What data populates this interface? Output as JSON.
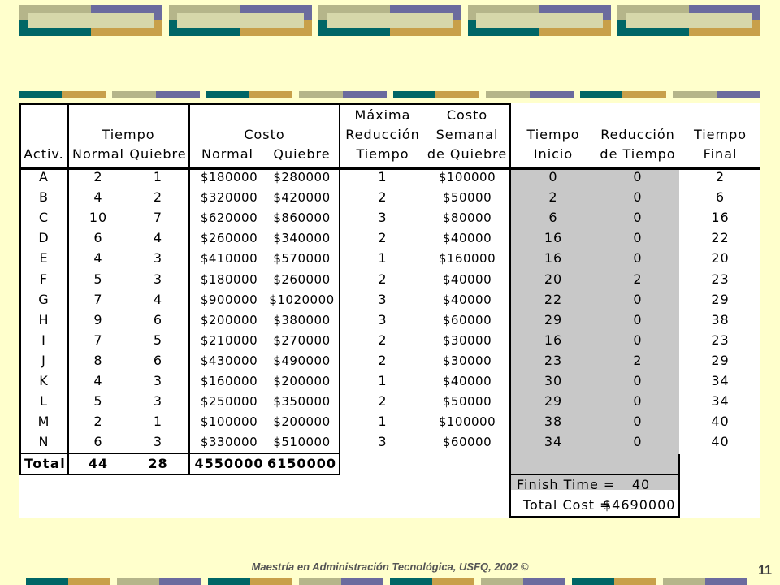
{
  "slide": {
    "footer": "Maestría en Administración Tecnológica, USFQ,  2002 ©",
    "page_number": "11",
    "colors": {
      "background": "#ffffcc",
      "teal": "#006666",
      "olive": "#b5b58a",
      "purple": "#6b6b9e",
      "gold": "#c8a04a",
      "gray_cell": "#c8c8c8"
    }
  },
  "table": {
    "headers": {
      "activ": "Activ.",
      "tiempo": "Tiempo",
      "normal_t": "Normal",
      "quiebre_t": "Quiebre",
      "costo": "Costo",
      "normal_c": "Normal",
      "quiebre_c": "Quiebre",
      "max_1": "Máxima",
      "max_2": "Reducción",
      "max_3": "Tiempo",
      "cs_1": "Costo",
      "cs_2": "Semanal",
      "cs_3": "de Quiebre",
      "ti_1": "Tiempo",
      "ti_2": "Inicio",
      "rt_1": "Reducción",
      "rt_2": "de Tiempo",
      "tf_1": "Tiempo",
      "tf_2": "Final"
    },
    "rows": [
      [
        "A",
        "2",
        "1",
        "$180000",
        "$280000",
        "1",
        "$100000",
        "0",
        "0",
        "2"
      ],
      [
        "B",
        "4",
        "2",
        "$320000",
        "$420000",
        "2",
        "$50000",
        "2",
        "0",
        "6"
      ],
      [
        "C",
        "10",
        "7",
        "$620000",
        "$860000",
        "3",
        "$80000",
        "6",
        "0",
        "16"
      ],
      [
        "D",
        "6",
        "4",
        "$260000",
        "$340000",
        "2",
        "$40000",
        "16",
        "0",
        "22"
      ],
      [
        "E",
        "4",
        "3",
        "$410000",
        "$570000",
        "1",
        "$160000",
        "16",
        "0",
        "20"
      ],
      [
        "F",
        "5",
        "3",
        "$180000",
        "$260000",
        "2",
        "$40000",
        "20",
        "2",
        "23"
      ],
      [
        "G",
        "7",
        "4",
        "$900000",
        "$1020000",
        "3",
        "$40000",
        "22",
        "0",
        "29"
      ],
      [
        "H",
        "9",
        "6",
        "$200000",
        "$380000",
        "3",
        "$60000",
        "29",
        "0",
        "38"
      ],
      [
        "I",
        "7",
        "5",
        "$210000",
        "$270000",
        "2",
        "$30000",
        "16",
        "0",
        "23"
      ],
      [
        "J",
        "8",
        "6",
        "$430000",
        "$490000",
        "2",
        "$30000",
        "23",
        "2",
        "29"
      ],
      [
        "K",
        "4",
        "3",
        "$160000",
        "$200000",
        "1",
        "$40000",
        "30",
        "0",
        "34"
      ],
      [
        "L",
        "5",
        "3",
        "$250000",
        "$350000",
        "2",
        "$50000",
        "29",
        "0",
        "34"
      ],
      [
        "M",
        "2",
        "1",
        "$100000",
        "$200000",
        "1",
        "$100000",
        "38",
        "0",
        "40"
      ],
      [
        "N",
        "6",
        "3",
        "$330000",
        "$510000",
        "3",
        "$60000",
        "34",
        "0",
        "40"
      ]
    ],
    "total": {
      "label": "Total",
      "normal_t": "44",
      "quiebre_t": "28",
      "normal_c": "4550000",
      "quiebre_c": "6150000"
    },
    "summary": {
      "finish_label": "Finish Time =",
      "finish_value": "40",
      "cost_label": "Total Cost =",
      "cost_value": "$4690000"
    }
  }
}
